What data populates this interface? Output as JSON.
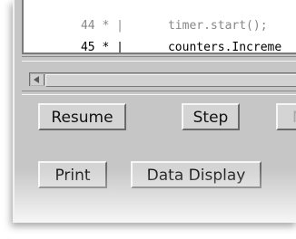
{
  "source": {
    "lines": [
      {
        "number": "44 * |",
        "code": "timer.start();"
      },
      {
        "number": "45 * |",
        "code": "counters.Increme"
      }
    ]
  },
  "buttons": {
    "resume": "Resume",
    "step": "Step",
    "next": "N",
    "print": "Print",
    "data_display": "Data Display"
  }
}
